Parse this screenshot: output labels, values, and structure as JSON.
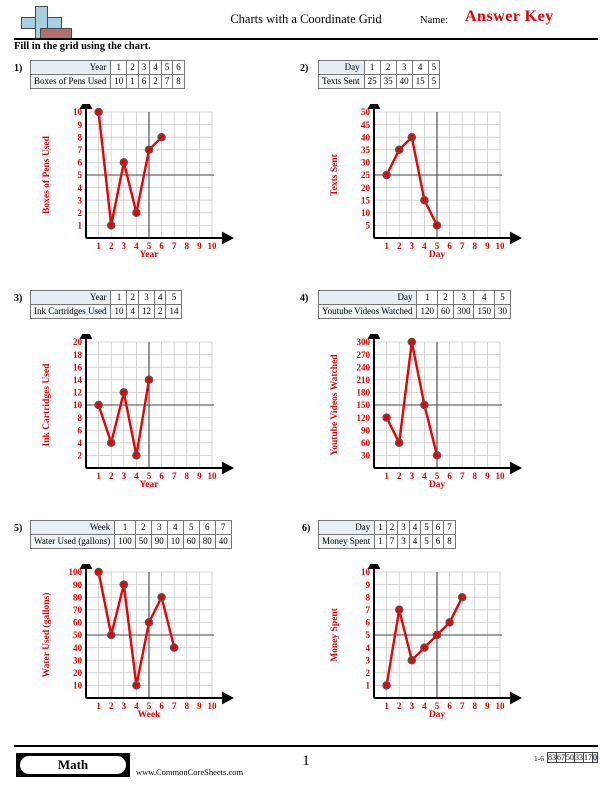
{
  "header": {
    "title": "Charts with a Coordinate Grid",
    "name_label": "Name:",
    "name_value": "Answer Key",
    "instructions": "Fill in the grid using the chart.",
    "logo_icon": "plus-block-logo"
  },
  "footer": {
    "subject": "Math",
    "site": "www.CommonCoreSheets.com",
    "page": "1",
    "scale_range": "1-6",
    "scale_values": [
      "83",
      "67",
      "50",
      "33",
      "17",
      "0"
    ],
    "scale_highlight_index": 5,
    "highlight_color": "#cddcf0"
  },
  "style": {
    "series_color": "#ee0000",
    "point_fill": "#ee0000",
    "point_stroke": "#555555",
    "grid_color": "#cccccc",
    "axis_color": "#000000",
    "mid_line_color": "#444444",
    "label_color": "#e00000"
  },
  "problems": [
    {
      "number": "1)",
      "table": {
        "header_label": "Year",
        "header_values": [
          "1",
          "2",
          "3",
          "4",
          "5",
          "6"
        ],
        "row_label": "Boxes of Pens Used",
        "row_values": [
          "10",
          "1",
          "6",
          "2",
          "7",
          "8"
        ]
      },
      "chart_data": {
        "type": "line",
        "title": "",
        "xlabel": "Year",
        "ylabel": "Boxes of Pens Used",
        "x": [
          1,
          2,
          3,
          4,
          5,
          6
        ],
        "values": [
          10,
          1,
          6,
          2,
          7,
          8
        ],
        "xticks": [
          "1",
          "2",
          "3",
          "4",
          "5",
          "6",
          "7",
          "8",
          "9",
          "10"
        ],
        "yticks": [
          "1",
          "2",
          "3",
          "4",
          "5",
          "6",
          "7",
          "8",
          "9",
          "10"
        ],
        "xlim": [
          0,
          10
        ],
        "ylim": [
          0,
          10
        ],
        "grid": true,
        "legend": "none"
      }
    },
    {
      "number": "2)",
      "table": {
        "header_label": "Day",
        "header_values": [
          "1",
          "2",
          "3",
          "4",
          "5"
        ],
        "row_label": "Texts Sent",
        "row_values": [
          "25",
          "35",
          "40",
          "15",
          "5"
        ]
      },
      "chart_data": {
        "type": "line",
        "title": "",
        "xlabel": "Day",
        "ylabel": "Texts Sent",
        "x": [
          1,
          2,
          3,
          4,
          5
        ],
        "values": [
          25,
          35,
          40,
          15,
          5
        ],
        "xticks": [
          "1",
          "2",
          "3",
          "4",
          "5",
          "6",
          "7",
          "8",
          "9",
          "10"
        ],
        "yticks": [
          "5",
          "10",
          "15",
          "20",
          "25",
          "30",
          "35",
          "40",
          "45",
          "50"
        ],
        "xlim": [
          0,
          10
        ],
        "ylim": [
          0,
          50
        ],
        "grid": true,
        "legend": "none"
      }
    },
    {
      "number": "3)",
      "table": {
        "header_label": "Year",
        "header_values": [
          "1",
          "2",
          "3",
          "4",
          "5"
        ],
        "row_label": "Ink Cartridges Used",
        "row_values": [
          "10",
          "4",
          "12",
          "2",
          "14"
        ]
      },
      "chart_data": {
        "type": "line",
        "title": "",
        "xlabel": "Year",
        "ylabel": "Ink Cartridges Used",
        "x": [
          1,
          2,
          3,
          4,
          5
        ],
        "values": [
          10,
          4,
          12,
          2,
          14
        ],
        "xticks": [
          "1",
          "2",
          "3",
          "4",
          "5",
          "6",
          "7",
          "8",
          "9",
          "10"
        ],
        "yticks": [
          "2",
          "4",
          "6",
          "8",
          "10",
          "12",
          "14",
          "16",
          "18",
          "20"
        ],
        "xlim": [
          0,
          10
        ],
        "ylim": [
          0,
          20
        ],
        "grid": true,
        "legend": "none"
      }
    },
    {
      "number": "4)",
      "table": {
        "header_label": "Day",
        "header_values": [
          "1",
          "2",
          "3",
          "4",
          "5"
        ],
        "row_label": "Youtube Videos Watched",
        "row_values": [
          "120",
          "60",
          "300",
          "150",
          "30"
        ]
      },
      "chart_data": {
        "type": "line",
        "title": "",
        "xlabel": "Day",
        "ylabel": "Youtube Videos Watched",
        "x": [
          1,
          2,
          3,
          4,
          5
        ],
        "values": [
          120,
          60,
          300,
          150,
          30
        ],
        "xticks": [
          "1",
          "2",
          "3",
          "4",
          "5",
          "6",
          "7",
          "8",
          "9",
          "10"
        ],
        "yticks": [
          "30",
          "60",
          "90",
          "120",
          "150",
          "180",
          "210",
          "240",
          "270",
          "300"
        ],
        "xlim": [
          0,
          10
        ],
        "ylim": [
          0,
          300
        ],
        "grid": true,
        "legend": "none"
      }
    },
    {
      "number": "5)",
      "table": {
        "header_label": "Week",
        "header_values": [
          "1",
          "2",
          "3",
          "4",
          "5",
          "6",
          "7"
        ],
        "row_label": "Water Used (gallons)",
        "row_values": [
          "100",
          "50",
          "90",
          "10",
          "60",
          "80",
          "40"
        ]
      },
      "chart_data": {
        "type": "line",
        "title": "",
        "xlabel": "Week",
        "ylabel": "Water Used (gallons)",
        "x": [
          1,
          2,
          3,
          4,
          5,
          6,
          7
        ],
        "values": [
          100,
          50,
          90,
          10,
          60,
          80,
          40
        ],
        "xticks": [
          "1",
          "2",
          "3",
          "4",
          "5",
          "6",
          "7",
          "8",
          "9",
          "10"
        ],
        "yticks": [
          "10",
          "20",
          "30",
          "40",
          "50",
          "60",
          "70",
          "80",
          "90",
          "100"
        ],
        "xlim": [
          0,
          10
        ],
        "ylim": [
          0,
          100
        ],
        "grid": true,
        "legend": "none"
      }
    },
    {
      "number": "6)",
      "table": {
        "header_label": "Day",
        "header_values": [
          "1",
          "2",
          "3",
          "4",
          "5",
          "6",
          "7"
        ],
        "row_label": "Money Spent",
        "row_values": [
          "1",
          "7",
          "3",
          "4",
          "5",
          "6",
          "8"
        ]
      },
      "chart_data": {
        "type": "line",
        "title": "",
        "xlabel": "Day",
        "ylabel": "Money Spent",
        "x": [
          1,
          2,
          3,
          4,
          5,
          6,
          7
        ],
        "values": [
          1,
          7,
          3,
          4,
          5,
          6,
          8
        ],
        "xticks": [
          "1",
          "2",
          "3",
          "4",
          "5",
          "6",
          "7",
          "8",
          "9",
          "10"
        ],
        "yticks": [
          "1",
          "2",
          "3",
          "4",
          "5",
          "6",
          "7",
          "8",
          "9",
          "10"
        ],
        "xlim": [
          0,
          10
        ],
        "ylim": [
          0,
          10
        ],
        "grid": true,
        "legend": "none"
      }
    }
  ]
}
